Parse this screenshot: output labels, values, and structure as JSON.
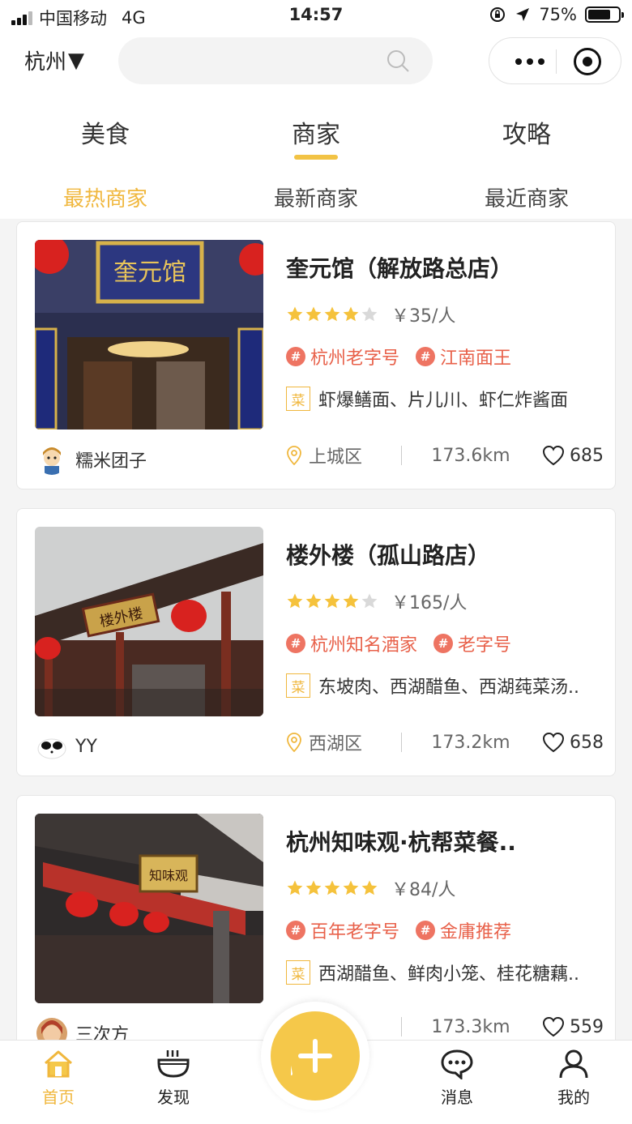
{
  "status_bar": {
    "carrier": "中国移动",
    "network": "4G",
    "time": "14:57",
    "battery": "75%",
    "battery_level": 0.75
  },
  "header": {
    "city": "杭州",
    "city_arrow": "▼",
    "search_placeholder": ""
  },
  "main_tabs": [
    {
      "label": "美食",
      "active": false
    },
    {
      "label": "商家",
      "active": true
    },
    {
      "label": "攻略",
      "active": false
    }
  ],
  "sub_tabs": [
    {
      "label": "最热商家",
      "active": true
    },
    {
      "label": "最新商家",
      "active": false
    },
    {
      "label": "最近商家",
      "active": false
    }
  ],
  "colors": {
    "accent": "#f0b73d",
    "tag_red": "#e8614a",
    "star": "#f5c23c",
    "star_empty": "#d9d9d9"
  },
  "merchants": [
    {
      "name": "奎元馆（解放路总店）",
      "rating": 4,
      "price": "￥35/人",
      "tags": [
        "杭州老字号",
        "江南面王"
      ],
      "dish_badge": "菜",
      "dishes": "虾爆鳝面、片儿川、虾仁炸酱面",
      "user": "糯米团子",
      "district": "上城区",
      "distance": "173.6km",
      "likes": "685"
    },
    {
      "name": "楼外楼（孤山路店）",
      "rating": 4,
      "price": "￥165/人",
      "tags": [
        "杭州知名酒家",
        "老字号"
      ],
      "dish_badge": "菜",
      "dishes": "东坡肉、西湖醋鱼、西湖莼菜汤..",
      "user": "YY",
      "district": "西湖区",
      "distance": "173.2km",
      "likes": "658"
    },
    {
      "name": "杭州知味观·杭帮菜餐..",
      "rating": 5,
      "price": "￥84/人",
      "tags": [
        "百年老字号",
        "金庸推荐"
      ],
      "dish_badge": "菜",
      "dishes": "西湖醋鱼、鲜肉小笼、桂花糖藕..",
      "user": "三次方",
      "district": "",
      "distance": "173.3km",
      "likes": "559"
    }
  ],
  "bottom_nav": {
    "home": "首页",
    "discover": "发现",
    "messages": "消息",
    "mine": "我的"
  }
}
